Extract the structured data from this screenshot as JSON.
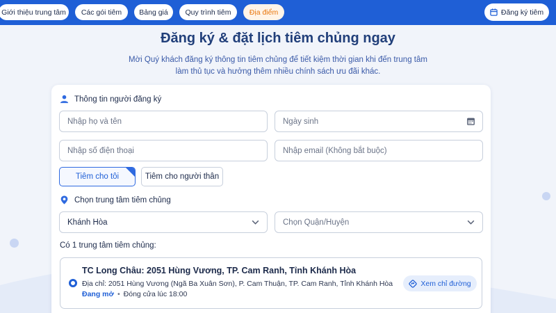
{
  "nav": {
    "items": [
      {
        "label": "Giới thiệu trung tâm",
        "active": false
      },
      {
        "label": "Các gói tiêm",
        "active": false
      },
      {
        "label": "Bảng giá",
        "active": false
      },
      {
        "label": "Quy trình tiêm",
        "active": false
      },
      {
        "label": "Địa điểm",
        "active": true
      }
    ],
    "register_button": "Đăng ký tiêm",
    "register_icon": "calendar-icon"
  },
  "header": {
    "title": "Đăng ký & đặt lịch tiêm chủng ngay",
    "subtitle": "Mời Quý khách đăng ký thông tin tiêm chủng để tiết kiệm thời gian khi đến trung tâm làm thủ tục và hưởng thêm nhiều chính sách ưu đãi khác."
  },
  "registrant": {
    "section_label": "Thông tin người đăng ký",
    "section_icon": "user-icon",
    "name_placeholder": "Nhập họ và tên",
    "dob_placeholder": "Ngày sinh",
    "dob_icon": "calendar-icon",
    "phone_placeholder": "Nhập số điện thoại",
    "email_placeholder": "Nhập email (Không bắt buộc)",
    "choices": [
      {
        "label": "Tiêm cho tôi",
        "selected": true
      },
      {
        "label": "Tiêm cho người thân",
        "selected": false
      }
    ]
  },
  "center_select": {
    "section_label": "Chọn trung tâm tiêm chủng",
    "section_icon": "map-pin-icon",
    "province_value": "Khánh Hòa",
    "district_placeholder": "Chọn Quận/Huyện",
    "count_label": "Có 1 trung tâm tiêm chủng:"
  },
  "centers": [
    {
      "name": "TC Long Châu: 2051 Hùng Vương, TP. Cam Ranh, Tỉnh Khánh Hòa",
      "address": "Địa chỉ: 2051 Hùng Vương (Ngã Ba Xuân Sơn), P. Cam Thuận, TP. Cam Ranh, Tỉnh Khánh Hòa",
      "status_open": "Đang mở",
      "separator": "•",
      "status_close": "Đóng cửa lúc 18:00",
      "directions_label": "Xem chỉ đường",
      "directions_icon": "directions-icon"
    }
  ],
  "colors": {
    "brand_blue": "#1f5fd6",
    "active_nav": "#e8750b",
    "title": "#213f7a"
  }
}
